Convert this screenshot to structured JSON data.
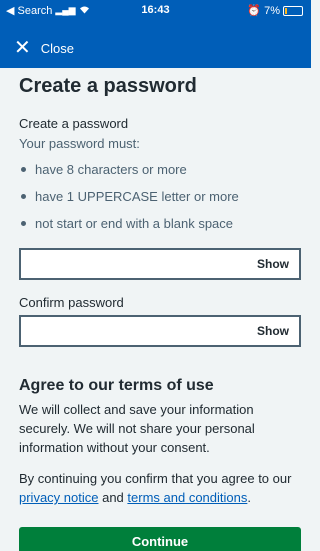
{
  "status_bar": {
    "back_app": "◀ Search",
    "time": "16:43",
    "battery": "7%"
  },
  "header": {
    "close_label": "Close"
  },
  "page": {
    "title": "Create a password",
    "field_label": "Create a password",
    "hint": "Your password must:",
    "rules": [
      "have 8 characters or more",
      "have 1 UPPERCASE letter or more",
      "not start or end with a blank space"
    ],
    "password_value": "",
    "show_label": "Show",
    "confirm_label": "Confirm password",
    "confirm_value": "",
    "confirm_show_label": "Show"
  },
  "terms": {
    "heading": "Agree to our terms of use",
    "para": "We will collect and save your information securely. We will not share your personal information without your consent.",
    "consent_prefix": "By continuing you confirm that you agree to our ",
    "privacy_link": "privacy notice",
    "and_text": " and ",
    "terms_link": "terms and conditions",
    "suffix": "."
  },
  "actions": {
    "continue_label": "Continue"
  },
  "colors": {
    "brand_blue": "#005eb8",
    "continue_green": "#007f3b",
    "background": "#f0f4f5"
  }
}
